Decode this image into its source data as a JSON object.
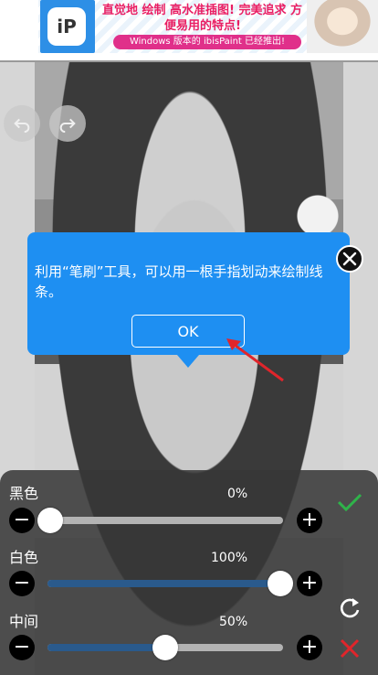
{
  "ad": {
    "logo_text": "iP",
    "headline_line1": "直觉地 绘制 高水准插图! 完美追求 方",
    "headline_line2": "便易用的特点!",
    "pill_text": "Windows 版本的 ibisPaint 已经推出!"
  },
  "toolbar": {
    "undo_icon": "undo-icon",
    "redo_icon": "redo-icon"
  },
  "tooltip": {
    "message": "利用“笔刷”工具，可以用一根手指划动来绘制线条。",
    "ok_label": "OK",
    "close_icon": "close-icon",
    "color": "#1e8ff2"
  },
  "levels_panel": {
    "sliders": [
      {
        "label": "黑色",
        "value_text": "0%",
        "value": 0
      },
      {
        "label": "白色",
        "value_text": "100%",
        "value": 100
      },
      {
        "label": "中间",
        "value_text": "50%",
        "value": 50
      }
    ],
    "minus_symbol": "−",
    "plus_symbol": "+",
    "confirm_icon": "checkmark-icon",
    "reset_icon": "reset-icon",
    "cancel_icon": "cancel-x-icon",
    "accent_fill": "#2a5a8c",
    "confirm_color": "#2fb34a",
    "cancel_color": "#e0252b"
  }
}
